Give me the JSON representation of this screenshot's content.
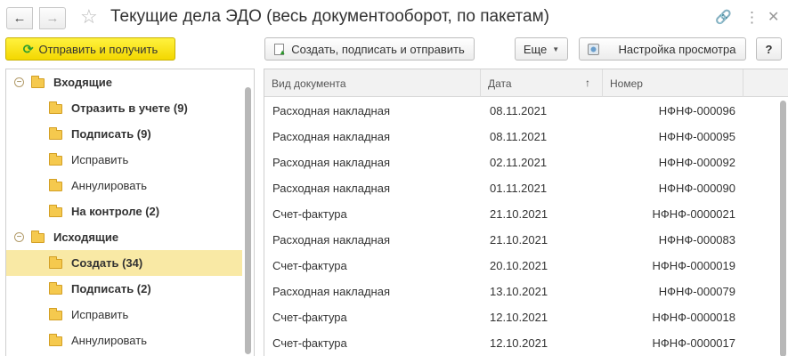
{
  "window": {
    "title": "Текущие дела ЭДО (весь документооборот, по пакетам)",
    "back_glyph": "←",
    "forward_glyph": "→",
    "favorite_glyph": "☆",
    "link_glyph": "🔗",
    "more_glyph": "⋮",
    "close_glyph": "✕"
  },
  "toolbar": {
    "send_receive_label": "Отправить и получить",
    "create_sign_send_label": "Создать, подписать и отправить",
    "more_label": "Еще",
    "view_settings_label": "Настройка просмотра",
    "help_label": "?"
  },
  "tree": {
    "groups": [
      {
        "label": "Входящие",
        "items": [
          {
            "label": "Отразить в учете (9)",
            "bold": true
          },
          {
            "label": "Подписать (9)",
            "bold": true
          },
          {
            "label": "Исправить",
            "bold": false
          },
          {
            "label": "Аннулировать",
            "bold": false
          },
          {
            "label": "На контроле (2)",
            "bold": true
          }
        ]
      },
      {
        "label": "Исходящие",
        "items": [
          {
            "label": "Создать (34)",
            "bold": true,
            "selected": true
          },
          {
            "label": "Подписать (2)",
            "bold": true
          },
          {
            "label": "Исправить",
            "bold": false
          },
          {
            "label": "Аннулировать",
            "bold": false
          }
        ]
      }
    ]
  },
  "table": {
    "columns": [
      "Вид документа",
      "Дата",
      "Номер"
    ],
    "sort_glyph": "↑",
    "rows": [
      {
        "type": "Расходная накладная",
        "date": "08.11.2021",
        "number": "НФНФ-000096"
      },
      {
        "type": "Расходная накладная",
        "date": "08.11.2021",
        "number": "НФНФ-000095"
      },
      {
        "type": "Расходная накладная",
        "date": "02.11.2021",
        "number": "НФНФ-000092"
      },
      {
        "type": "Расходная накладная",
        "date": "01.11.2021",
        "number": "НФНФ-000090"
      },
      {
        "type": "Счет-фактура",
        "date": "21.10.2021",
        "number": "НФНФ-0000021"
      },
      {
        "type": "Расходная накладная",
        "date": "21.10.2021",
        "number": "НФНФ-000083"
      },
      {
        "type": "Счет-фактура",
        "date": "20.10.2021",
        "number": "НФНФ-0000019"
      },
      {
        "type": "Расходная накладная",
        "date": "13.10.2021",
        "number": "НФНФ-000079"
      },
      {
        "type": "Счет-фактура",
        "date": "12.10.2021",
        "number": "НФНФ-0000018"
      },
      {
        "type": "Счет-фактура",
        "date": "12.10.2021",
        "number": "НФНФ-0000017"
      }
    ]
  },
  "colors": {
    "accent_button": "#f3d700",
    "selected_row": "#f9e9a5",
    "folder": "#f5c94e"
  }
}
